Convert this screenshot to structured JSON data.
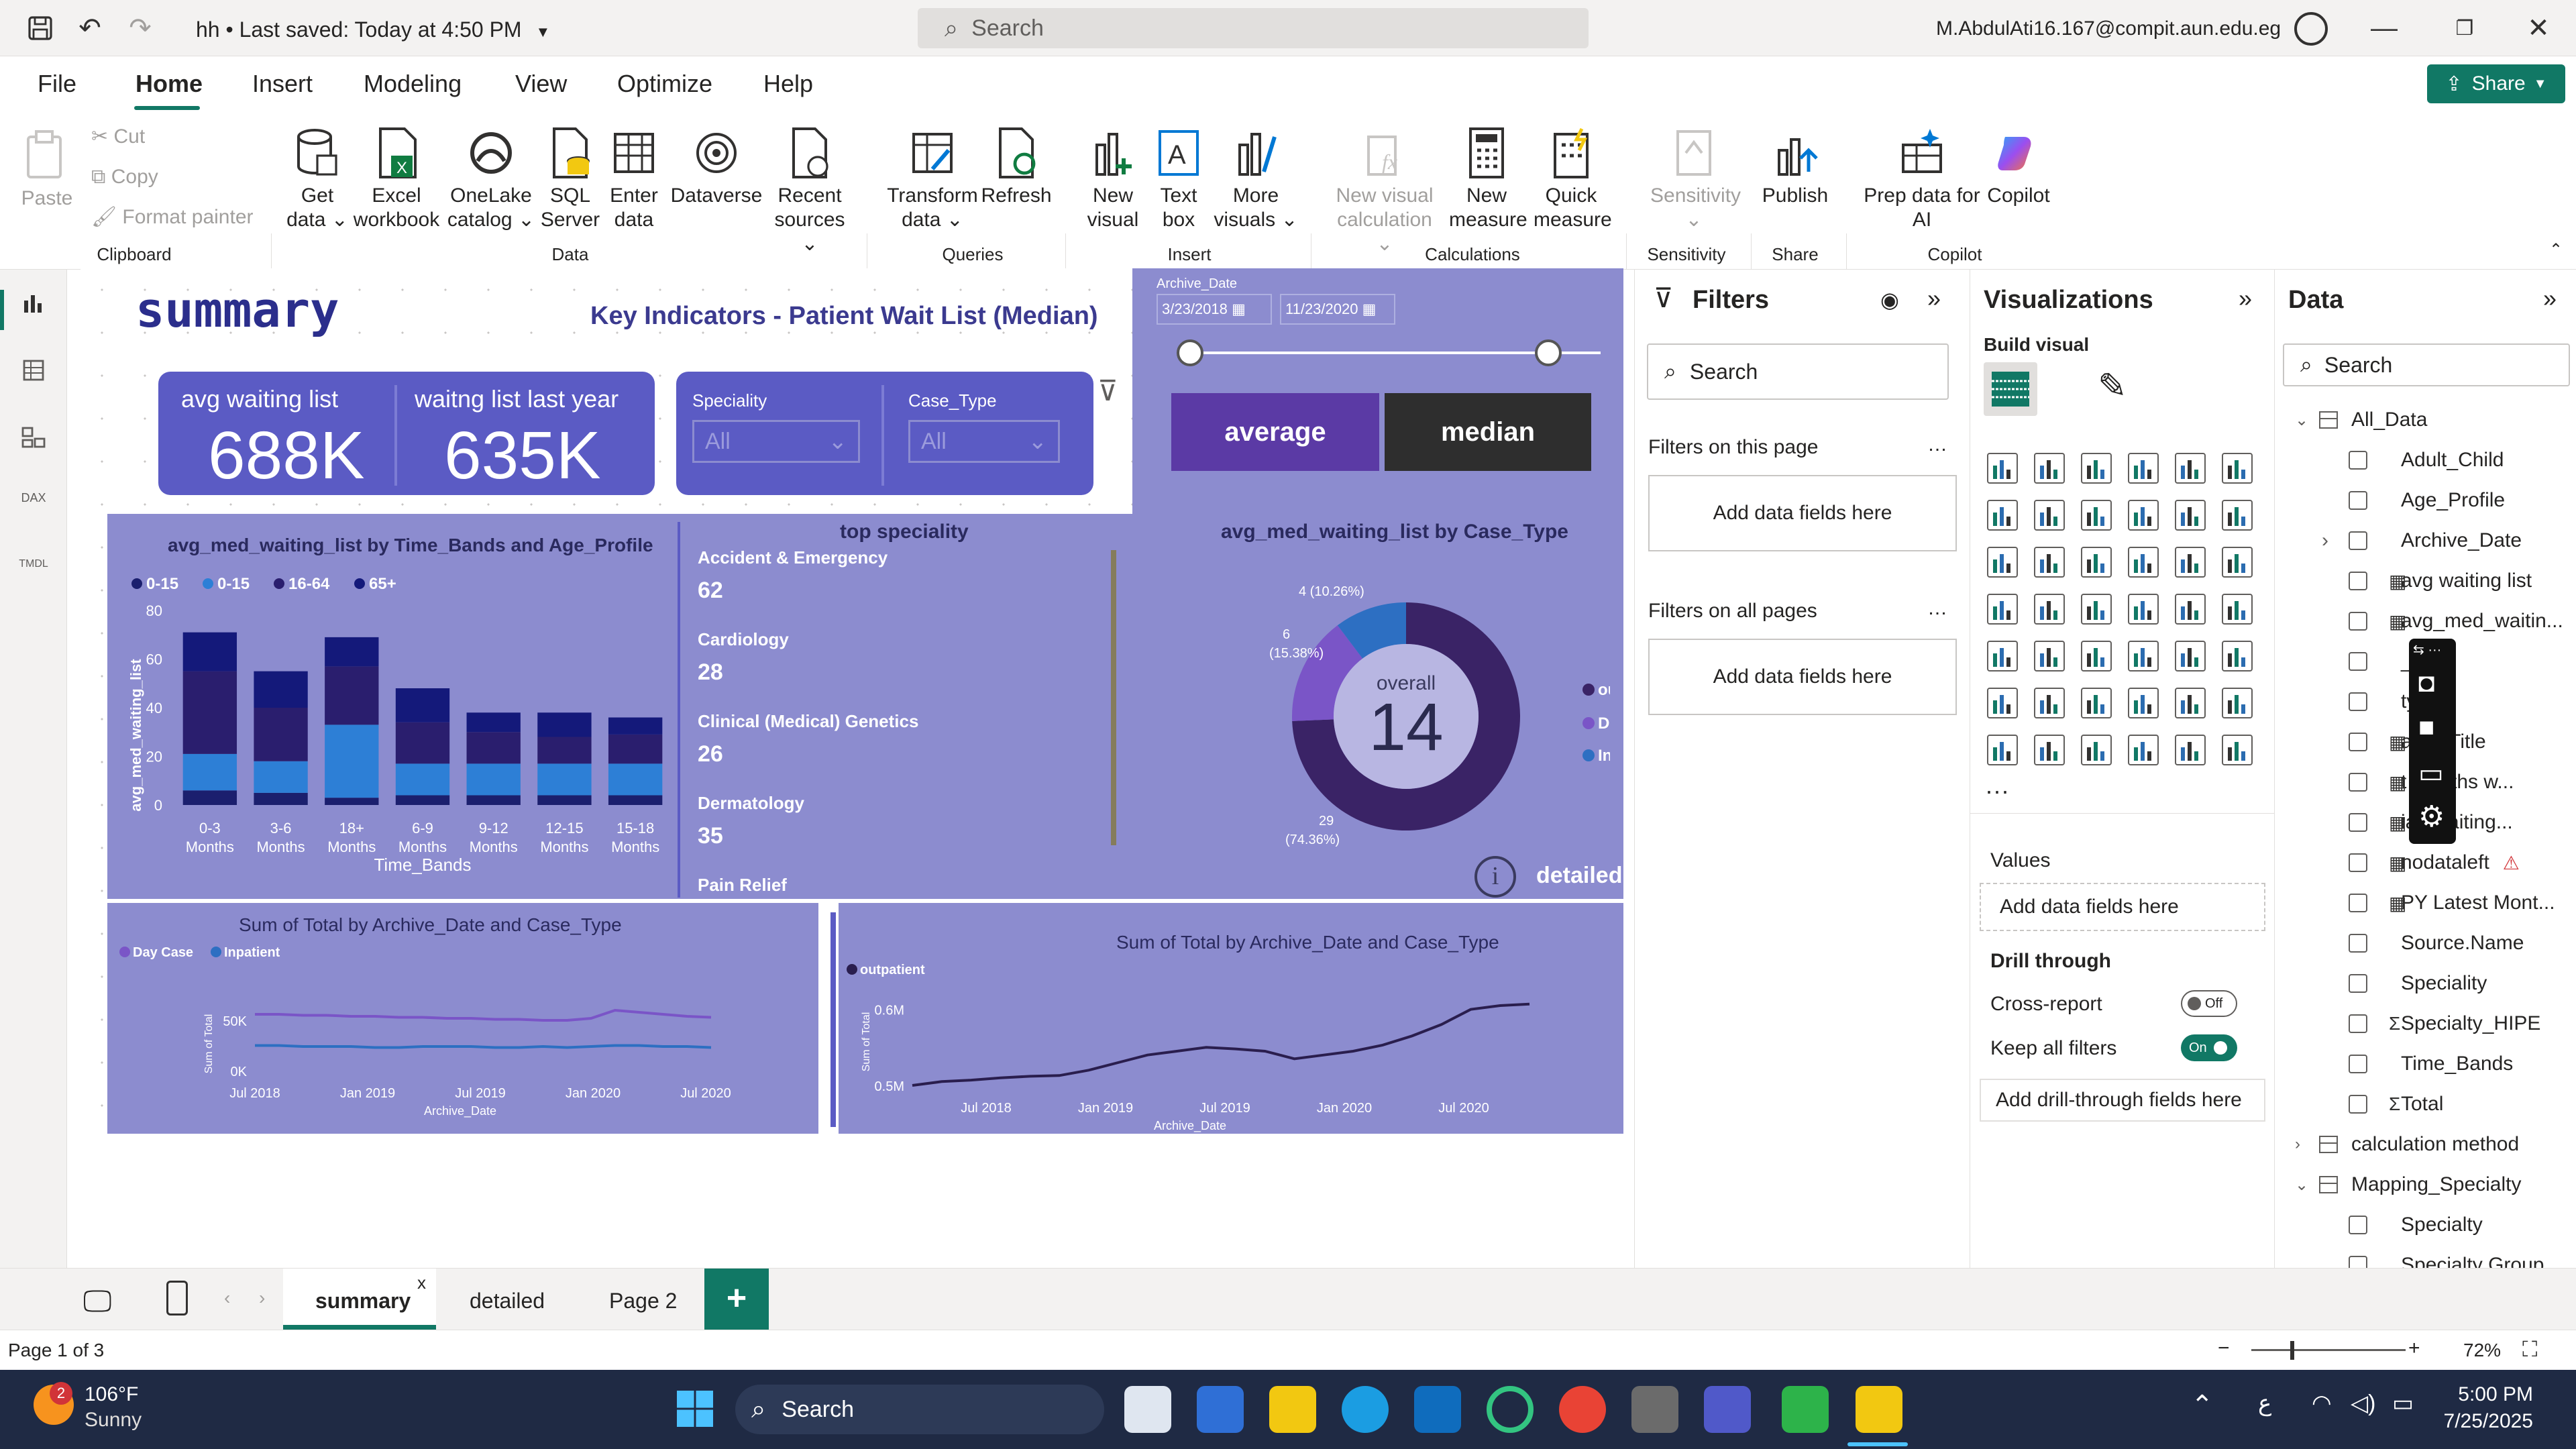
{
  "title_bar": {
    "file_name": "hh",
    "save_status": "Last saved: Today at 4:50 PM",
    "search_placeholder": "Search",
    "user_email": "M.AbdulAti16.167@compit.aun.edu.eg"
  },
  "menu": {
    "items": [
      "File",
      "Home",
      "Insert",
      "Modeling",
      "View",
      "Optimize",
      "Help"
    ],
    "active": "Home",
    "share_label": "Share"
  },
  "ribbon": {
    "clipboard": {
      "paste": "Paste",
      "cut": "Cut",
      "copy": "Copy",
      "format_painter": "Format painter",
      "group": "Clipboard"
    },
    "data": {
      "get_data": "Get data",
      "excel": "Excel workbook",
      "onelake": "OneLake catalog",
      "sql": "SQL Server",
      "enter": "Enter data",
      "dataverse": "Dataverse",
      "recent": "Recent sources",
      "group": "Data"
    },
    "queries": {
      "transform": "Transform data",
      "refresh": "Refresh",
      "group": "Queries"
    },
    "insert": {
      "new_visual": "New visual",
      "text_box": "Text box",
      "more_visuals": "More visuals",
      "group": "Insert"
    },
    "calculations": {
      "new_visual_calc": "New visual calculation",
      "new_measure": "New measure",
      "quick_measure": "Quick measure",
      "group": "Calculations"
    },
    "sensitivity": {
      "label": "Sensitivity",
      "group": "Sensitivity"
    },
    "share": {
      "publish": "Publish",
      "group": "Share"
    },
    "copilot": {
      "prep": "Prep data for AI",
      "copilot": "Copilot",
      "group": "Copilot"
    }
  },
  "report": {
    "title": "summary",
    "subtitle": "Key Indicators - Patient Wait List (Median)",
    "kpi": {
      "avg_label": "avg waiting list",
      "avg_value": "688K",
      "last_year_label": "waitng list last year",
      "last_year_value": "635K"
    },
    "slicers": {
      "speciality_label": "Speciality",
      "speciality_value": "All",
      "case_type_label": "Case_Type",
      "case_type_value": "All"
    },
    "date_slicer": {
      "label": "Archive_Date",
      "start": "3/23/2018",
      "end": "11/23/2020"
    },
    "buttons": {
      "average": "average",
      "median": "median",
      "detailed": "detailed"
    },
    "top_speciality": {
      "title": "top speciality",
      "items": [
        {
          "name": "Accident & Emergency",
          "value": "62"
        },
        {
          "name": "Cardiology",
          "value": "28"
        },
        {
          "name": "Clinical (Medical) Genetics",
          "value": "26"
        },
        {
          "name": "Dermatology",
          "value": "35"
        },
        {
          "name": "Pain Relief",
          "value": ""
        }
      ]
    },
    "donut_title": "avg_med_waiting_list by Case_Type",
    "donut_center_label": "overall",
    "donut_center_value": "14",
    "donut_labels": [
      "4 (10.26%)",
      "6 (15.38%)",
      "29 (74.36%)"
    ]
  },
  "chart_data": [
    {
      "type": "bar",
      "title": "avg_med_waiting_list by Time_Bands and Age_Profile",
      "xlabel": "Time_Bands",
      "ylabel": "avg_med_waiting_list",
      "ylim": [
        0,
        80
      ],
      "yticks": [
        0,
        20,
        40,
        60,
        80
      ],
      "categories": [
        "0-3 Months",
        "3-6 Months",
        "18+ Months",
        "6-9 Months",
        "9-12 Months",
        "12-15 Months",
        "15-18 Months"
      ],
      "series": [
        {
          "name": "0-15",
          "color": "#1b1f6e",
          "values": [
            6,
            5,
            3,
            4,
            4,
            4,
            4
          ]
        },
        {
          "name": "0-15",
          "color": "#2d7fd6",
          "values": [
            15,
            13,
            30,
            13,
            13,
            13,
            13
          ]
        },
        {
          "name": "16-64",
          "color": "#2a1e6e",
          "values": [
            34,
            22,
            24,
            17,
            13,
            11,
            12
          ]
        },
        {
          "name": "65+",
          "color": "#14197a",
          "values": [
            16,
            15,
            12,
            14,
            8,
            10,
            7
          ]
        }
      ],
      "stacked": true,
      "legend": "top-left"
    },
    {
      "type": "donut",
      "title": "avg_med_waiting_list by Case_Type",
      "categories": [
        "outpatient",
        "Day Case",
        "Inpatient"
      ],
      "values": [
        29,
        6,
        4
      ],
      "colors": [
        "#3a2366",
        "#7a55c7",
        "#2d6fc2"
      ],
      "legend": "right"
    },
    {
      "type": "line",
      "title": "Sum of Total by Archive_Date and Case_Type",
      "xlabel": "Archive_Date",
      "ylabel": "Sum of Total",
      "xticks": [
        "Jul 2018",
        "Jan 2019",
        "Jul 2019",
        "Jan 2020",
        "Jul 2020"
      ],
      "yticks": [
        "0K",
        "50K"
      ],
      "ylim": [
        0,
        80
      ],
      "series": [
        {
          "name": "Day Case",
          "color": "#7a55c7",
          "values": [
            56,
            56,
            55,
            55,
            54,
            54,
            53,
            53,
            52,
            52,
            51,
            51,
            50,
            50,
            52,
            60,
            58,
            56,
            54,
            53
          ]
        },
        {
          "name": "Inpatient",
          "color": "#2d6fc2",
          "values": [
            25,
            25,
            24,
            24,
            24,
            23,
            23,
            24,
            24,
            24,
            23,
            23,
            24,
            23,
            24,
            25,
            25,
            24,
            24,
            23
          ]
        }
      ],
      "legend": "top-left"
    },
    {
      "type": "line",
      "title": "Sum of Total by Archive_Date and Case_Type",
      "xlabel": "Archive_Date",
      "ylabel": "Sum of Total",
      "xticks": [
        "Jul 2018",
        "Jan 2019",
        "Jul 2019",
        "Jan 2020",
        "Jul 2020"
      ],
      "yticks": [
        "0.5M",
        "0.6M"
      ],
      "ylim": [
        0.5,
        0.65
      ],
      "series": [
        {
          "name": "outpatient",
          "color": "#2a1e4e",
          "values": [
            0.5,
            0.505,
            0.507,
            0.51,
            0.512,
            0.513,
            0.52,
            0.53,
            0.54,
            0.545,
            0.55,
            0.548,
            0.545,
            0.535,
            0.54,
            0.545,
            0.553,
            0.565,
            0.58,
            0.6,
            0.605,
            0.607
          ]
        }
      ],
      "legend": "top-left"
    }
  ],
  "filters_pane": {
    "title": "Filters",
    "search": "Search",
    "on_page": "Filters on this page",
    "on_all": "Filters on all pages",
    "add_fields": "Add data fields here"
  },
  "viz_pane": {
    "title": "Visualizations",
    "build": "Build visual",
    "values": "Values",
    "add_fields": "Add data fields here",
    "drill": "Drill through",
    "cross_report": "Cross-report",
    "cross_state": "Off",
    "keep_filters": "Keep all filters",
    "keep_state": "On",
    "add_drill": "Add drill-through fields here"
  },
  "data_pane": {
    "title": "Data",
    "search": "Search",
    "fields": [
      {
        "label": "All_Data",
        "kind": "table",
        "level": 0,
        "expanded": true
      },
      {
        "label": "Adult_Child",
        "kind": "field",
        "level": 1
      },
      {
        "label": "Age_Profile",
        "kind": "field",
        "level": 1
      },
      {
        "label": "Archive_Date",
        "kind": "field",
        "level": 1,
        "expandable": true
      },
      {
        "label": "avg waiting list",
        "kind": "measure",
        "level": 1
      },
      {
        "label": "avg_med_waitin...",
        "kind": "measure",
        "level": 1
      },
      {
        "label": "_Type",
        "kind": "field",
        "level": 1
      },
      {
        "label": "type 2",
        "kind": "field",
        "level": 1
      },
      {
        "label": "amic Title",
        "kind": "measure",
        "level": 1
      },
      {
        "label": "t months w...",
        "kind": "measure",
        "level": 1
      },
      {
        "label": "ian waiting...",
        "kind": "measure",
        "level": 1
      },
      {
        "label": "nodataleft",
        "kind": "measure",
        "level": 1,
        "warn": true
      },
      {
        "label": "PY Latest Mont...",
        "kind": "measure",
        "level": 1
      },
      {
        "label": "Source.Name",
        "kind": "field",
        "level": 1
      },
      {
        "label": "Speciality",
        "kind": "field",
        "level": 1
      },
      {
        "label": "Specialty_HIPE",
        "kind": "sum",
        "level": 1
      },
      {
        "label": "Time_Bands",
        "kind": "field",
        "level": 1
      },
      {
        "label": "Total",
        "kind": "sum",
        "level": 1
      },
      {
        "label": "calculation method",
        "kind": "table",
        "level": 0,
        "expanded": false
      },
      {
        "label": "Mapping_Specialty",
        "kind": "table",
        "level": 0,
        "expanded": true
      },
      {
        "label": "Specialty",
        "kind": "field",
        "level": 1
      },
      {
        "label": "Specialty Group",
        "kind": "field",
        "level": 1
      }
    ]
  },
  "tabs": {
    "items": [
      "summary",
      "detailed",
      "Page 2"
    ],
    "active": "summary",
    "add": "+"
  },
  "status": {
    "page": "Page 1 of 3",
    "zoom": "72%"
  },
  "taskbar": {
    "weather_temp": "106°F",
    "weather_desc": "Sunny",
    "weather_badge": "2",
    "search": "Search",
    "time": "5:00 PM",
    "date": "7/25/2025",
    "lang": "ع"
  }
}
